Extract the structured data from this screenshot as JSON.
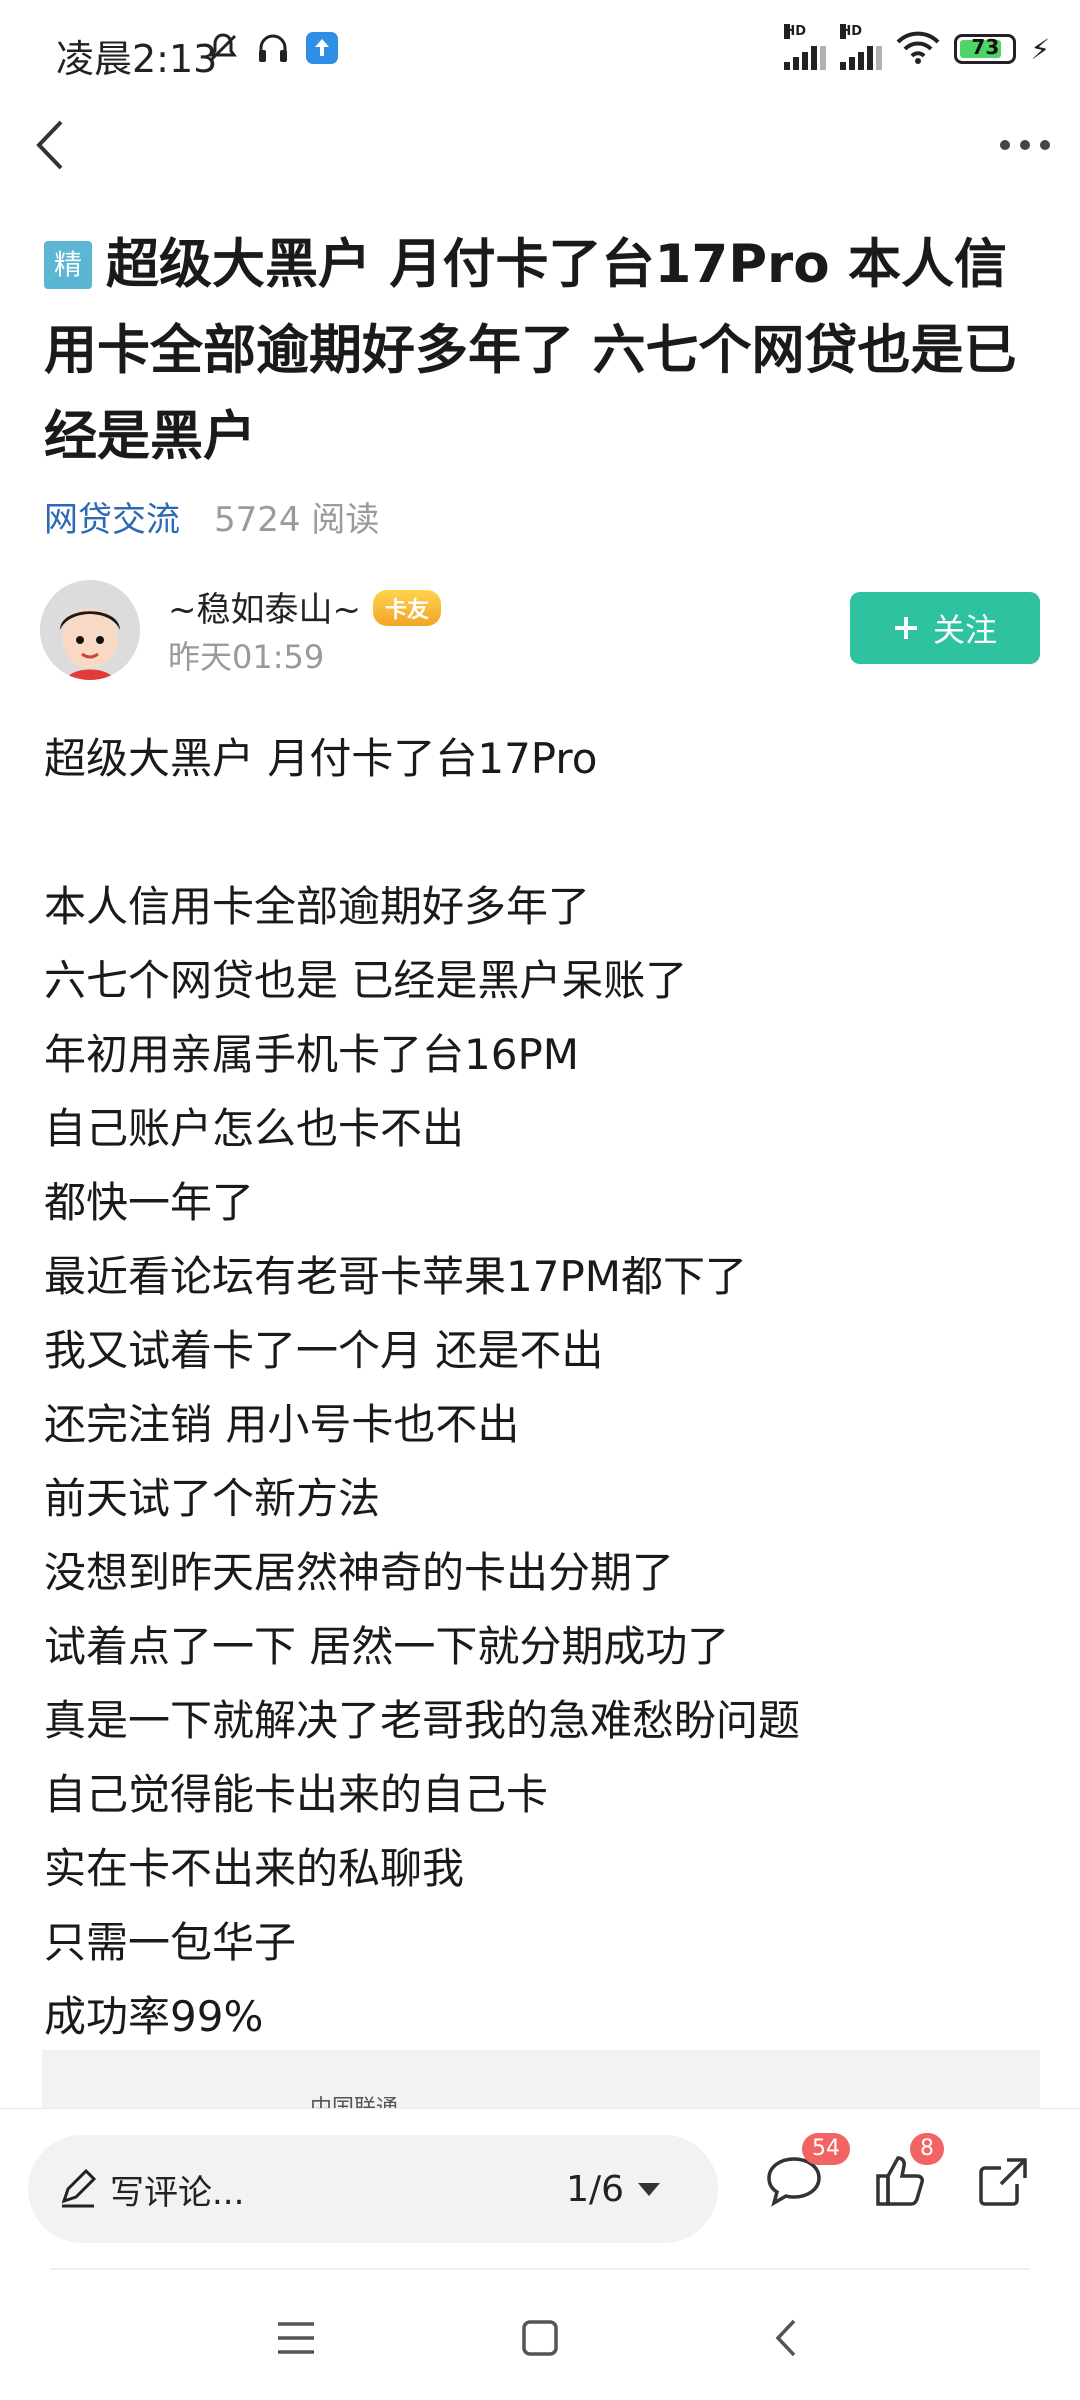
{
  "status_bar": {
    "time": "凌晨2:13",
    "battery": "73",
    "hd_label": "HD",
    "icons": [
      "silent-icon",
      "headset-icon",
      "upload-icon",
      "signal-icon",
      "wifi-icon",
      "battery-icon",
      "charging-icon"
    ]
  },
  "nav": {
    "back_icon": "chevron-left-icon",
    "more_icon": "more-horizontal-icon"
  },
  "post": {
    "badge": "精",
    "title": "超级大黑户 月付卡了台17Pro 本人信用卡全部逾期好多年了 六七个网贷也是已经是黑户",
    "forum": "网贷交流",
    "read_count": "5724 阅读",
    "author": {
      "name": "~稳如泰山~",
      "badge": "卡友",
      "time": "昨天01:59"
    },
    "follow_label": "关注",
    "body_lines": [
      "超级大黑户 月付卡了台17Pro",
      "",
      "本人信用卡全部逾期好多年了",
      "六七个网贷也是 已经是黑户呆账了",
      "年初用亲属手机卡了台16PM",
      "自己账户怎么也卡不出",
      "都快一年了",
      "最近看论坛有老哥卡苹果17PM都下了",
      "我又试着卡了一个月 还是不出",
      "还完注销 用小号卡也不出",
      "前天试了个新方法",
      "没想到昨天居然神奇的卡出分期了",
      "试着点了一下 居然一下就分期成功了",
      "真是一下就解决了老哥我的急难愁盼问题",
      "自己觉得能卡出来的自己卡",
      "实在卡不出来的私聊我",
      "只需一包华子",
      "成功率99%"
    ],
    "image_preview_text": "中国联通"
  },
  "action_bar": {
    "comment_placeholder": "写评论...",
    "page_indicator": "1/6",
    "comments_count": "54",
    "likes_count": "8"
  },
  "colors": {
    "accent_teal": "#2ec2a0",
    "link_blue": "#2d68b4",
    "badge_red": "#f26363",
    "jing_badge": "#5ab6d2"
  }
}
